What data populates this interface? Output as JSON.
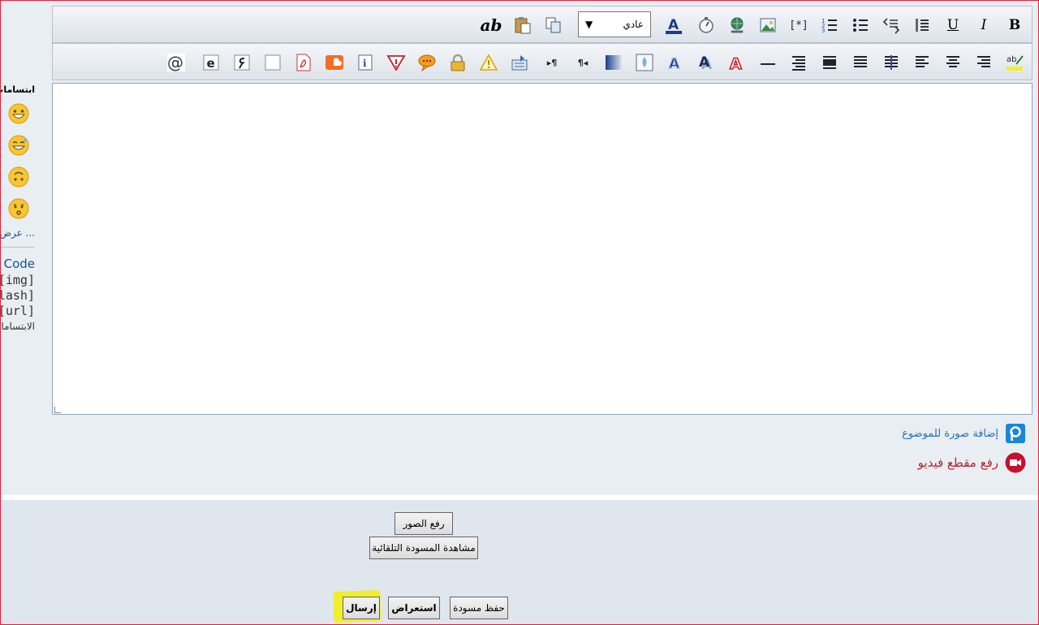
{
  "sidebar": {
    "title": "ابتسامات",
    "smilies": [
      "grinning-face-icon",
      "sweat-smile-icon",
      "upside-down-face-icon",
      "kissing-face-icon"
    ],
    "more_label": "عرض ...",
    "code_label": "Code",
    "img_label": "[img]",
    "flash_label": "flash]",
    "url_label": "[url]",
    "smilies_label": "الابتسامات"
  },
  "toolbar": {
    "font_size_value": "عادي",
    "font_size_arrow": "▼",
    "bold_label": "B",
    "italic_label": "I",
    "underline_label": "U",
    "ab_label": "ab",
    "ltr_label": "▸¶",
    "rtl_label": "¶◂",
    "bracket_label": "[*]"
  },
  "attachments": {
    "add_photo_label": "إضافة صورة للموضوع",
    "upload_video_label": "رفع مقطع فيديو"
  },
  "buttons": {
    "upload_images": "رفع الصور",
    "view_autosave": "مشاهدة المسودة التلقائية",
    "submit": "إرسال",
    "preview": "استعراض",
    "save_draft": "حفظ مسودة"
  },
  "colors": {
    "frame_border": "#e0203a",
    "submit_highlight": "#f1ee2b",
    "photo_link": "#2a6fb5",
    "video_link": "#c0202a"
  }
}
